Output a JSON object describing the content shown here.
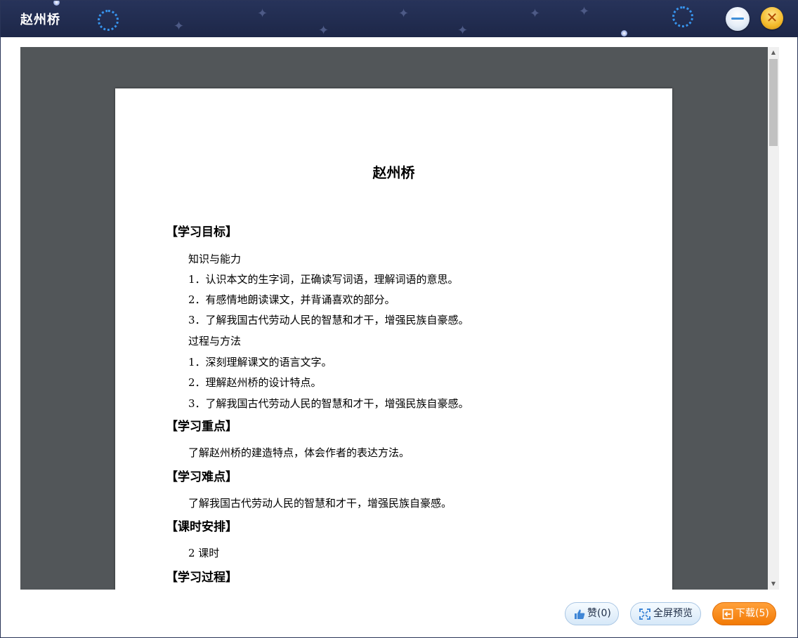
{
  "window": {
    "title": "赵州桥"
  },
  "document": {
    "title": "赵州桥",
    "sections": [
      {
        "heading": "【学习目标】",
        "lines": [
          "知识与能力",
          "1．认识本文的生字词，正确读写词语，理解词语的意思。",
          "2．有感情地朗读课文，并背诵喜欢的部分。",
          "3．了解我国古代劳动人民的智慧和才干，增强民族自豪感。",
          "过程与方法",
          "1．深刻理解课文的语言文字。",
          "2．理解赵州桥的设计特点。",
          "3．了解我国古代劳动人民的智慧和才干，增强民族自豪感。"
        ]
      },
      {
        "heading": "【学习重点】",
        "lines": [
          "了解赵州桥的建造特点，体会作者的表达方法。"
        ]
      },
      {
        "heading": "【学习难点】",
        "lines": [
          "了解我国古代劳动人民的智慧和才干，增强民族自豪感。"
        ]
      },
      {
        "heading": "【课时安排】",
        "lines": [
          "2 课时"
        ]
      },
      {
        "heading": "【学习过程】",
        "lines": []
      }
    ]
  },
  "footer": {
    "like_label": "赞(0)",
    "fullscreen_label": "全屏预览",
    "download_label": "下载(5)"
  },
  "icons": {
    "minimize": "minimize-icon",
    "close": "close-icon",
    "like": "thumbs-up-icon",
    "fullscreen": "fullscreen-icon",
    "download": "download-icon"
  },
  "colors": {
    "titlebar": "#222d50",
    "viewer_background": "#525659",
    "download_button": "#f7870f",
    "light_button": "#dbeaf8"
  }
}
